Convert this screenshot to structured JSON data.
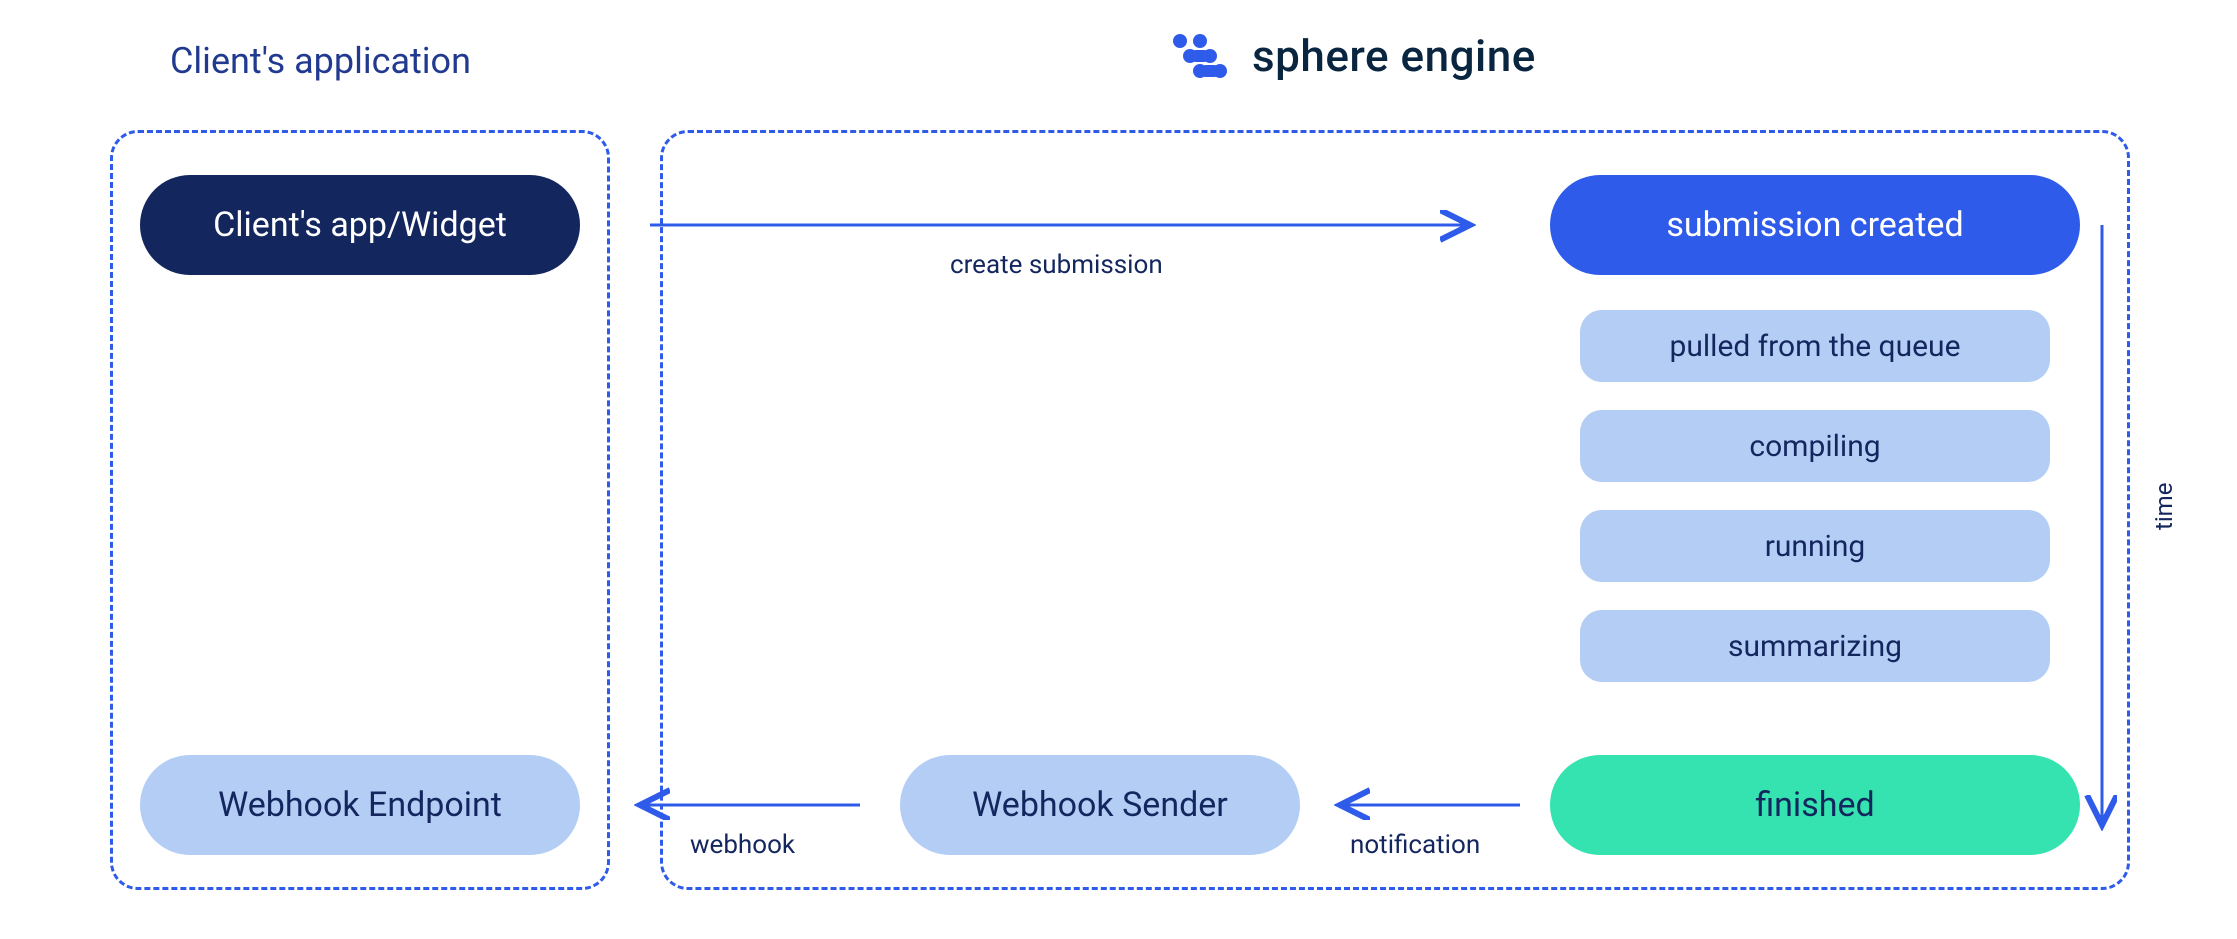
{
  "headers": {
    "client_app": "Client's application",
    "brand": "sphere engine"
  },
  "nodes": {
    "client_widget": "Client's app/Widget",
    "webhook_endpoint": "Webhook Endpoint",
    "submission_created": "submission created",
    "webhook_sender": "Webhook Sender",
    "finished": "finished"
  },
  "stages": [
    "pulled from the queue",
    "compiling",
    "running",
    "summarizing"
  ],
  "edges": {
    "create_submission": "create submission",
    "notification": "notification",
    "webhook": "webhook",
    "time": "time"
  },
  "colors": {
    "dashed_border": "#2f5bea",
    "dark_navy": "#14265e",
    "bright_blue": "#2f5bea",
    "light_blue": "#b4cdf5",
    "teal": "#34e3b0"
  }
}
